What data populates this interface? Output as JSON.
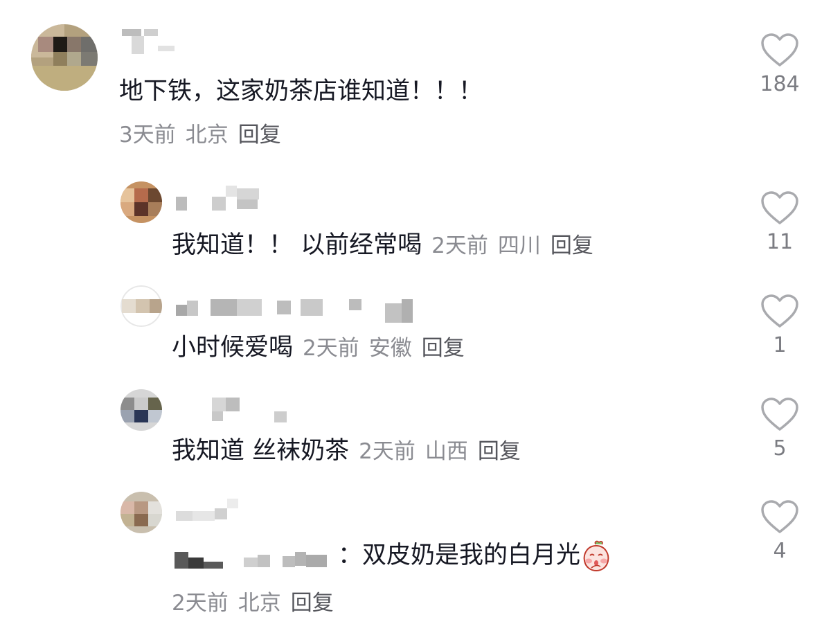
{
  "comments": [
    {
      "text": "地下铁，这家奶茶店谁知道！！！",
      "time": "3天前",
      "location": "北京",
      "reply_label": "回复",
      "likes": "184"
    }
  ],
  "replies": [
    {
      "text": "我知道！！ 以前经常喝",
      "time": "2天前",
      "location": "四川",
      "reply_label": "回复",
      "likes": "11"
    },
    {
      "text": "小时候爱喝",
      "time": "2天前",
      "location": "安徽",
      "reply_label": "回复",
      "likes": "1"
    },
    {
      "text": "我知道 丝袜奶茶",
      "time": "2天前",
      "location": "山西",
      "reply_label": "回复",
      "likes": "5"
    },
    {
      "text": "：双皮奶是我的白月光",
      "emoji": "shy-peach-emoji",
      "time": "2天前",
      "location": "北京",
      "reply_label": "回复",
      "likes": "4"
    }
  ],
  "colors": {
    "text": "#161823",
    "meta": "#8a8b91",
    "heart_stroke": "#a9aaae"
  },
  "icons": {
    "like": "heart-outline-icon"
  }
}
